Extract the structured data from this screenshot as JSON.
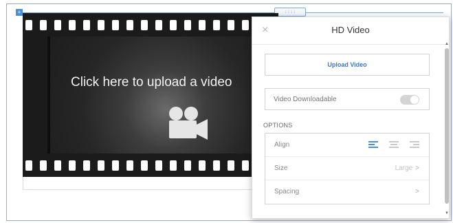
{
  "editor": {
    "handle_label": "::::",
    "corner_marker": "+",
    "placeholder_text": "Click here to upload a video",
    "camera_icon": "video-camera-icon"
  },
  "panel": {
    "title": "HD Video",
    "close_icon": "×",
    "upload_button": "Upload Video",
    "downloadable_label": "Video Downloadable",
    "downloadable_on": false,
    "options_heading": "OPTIONS",
    "align_label": "Align",
    "align_selected": "left",
    "size_label": "Size",
    "size_value": "Large",
    "spacing_label": "Spacing",
    "chevron": ">"
  },
  "colors": {
    "accent": "#3a78c8",
    "film": "#1b1b1b",
    "toggle_off": "#d4d4d4"
  }
}
